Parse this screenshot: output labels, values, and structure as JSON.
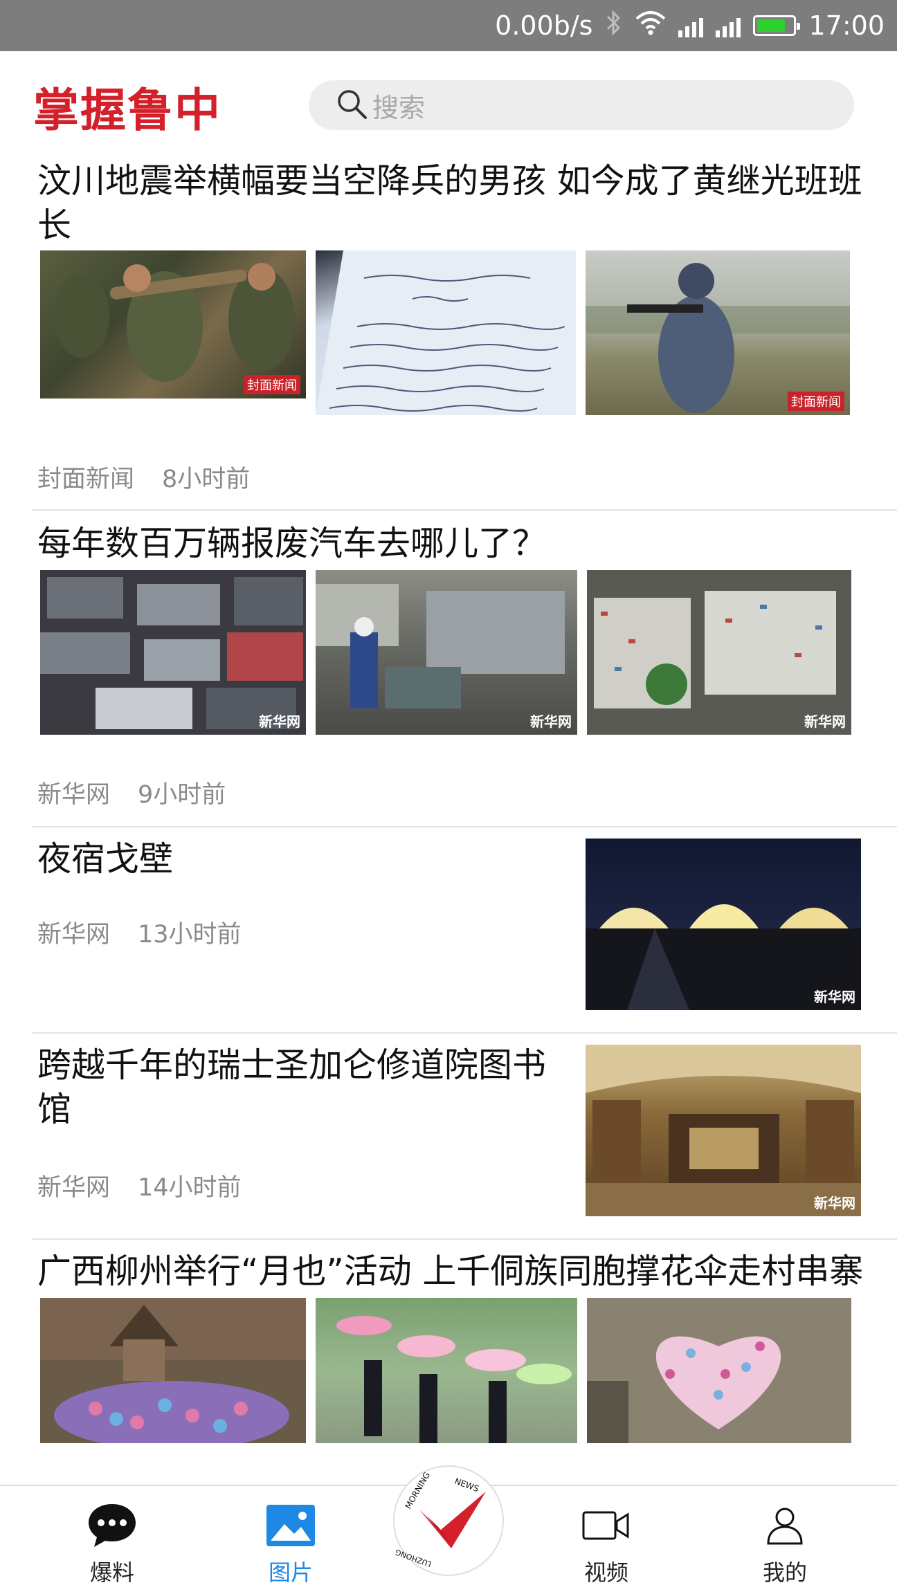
{
  "status_bar": {
    "net_speed": "0.00b/s",
    "time": "17:00",
    "battery_color": "#2fd12f"
  },
  "header": {
    "logo_text": "掌握鲁中",
    "search_placeholder": "搜索",
    "brand_color": "#d3202a"
  },
  "feed": [
    {
      "title": "汶川地震举横幅要当空降兵的男孩 如今成了黄继光班班长",
      "source": "封面新闻",
      "time": "8小时前",
      "layout": "three-images",
      "image_watermark": "封面新闻"
    },
    {
      "title": "每年数百万辆报废汽车去哪儿了？",
      "source": "新华网",
      "time": "9小时前",
      "layout": "three-images",
      "image_watermark": "新华网"
    },
    {
      "title": "夜宿戈壁",
      "source": "新华网",
      "time": "13小时前",
      "layout": "single-image",
      "image_watermark": "新华网"
    },
    {
      "title": "跨越千年的瑞士圣加仑修道院图书馆",
      "source": "新华网",
      "time": "14小时前",
      "layout": "single-image",
      "image_watermark": "新华网"
    },
    {
      "title": "广西柳州举行“月也”活动 上千侗族同胞撑花伞走村串寨",
      "layout": "three-images"
    }
  ],
  "bottom_nav": {
    "items": [
      {
        "label": "爆料",
        "icon": "chat-bubble-icon"
      },
      {
        "label": "图片",
        "icon": "picture-icon",
        "active": true
      },
      {
        "label": "视频",
        "icon": "video-camera-icon"
      },
      {
        "label": "我的",
        "icon": "person-icon"
      }
    ],
    "center_logo_text": "MORNING NEWS · LUZHONG",
    "active_color": "#1e88e5"
  }
}
